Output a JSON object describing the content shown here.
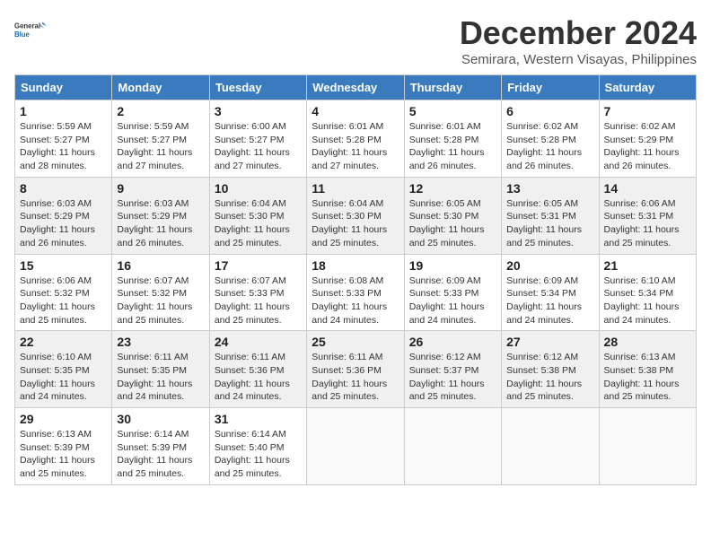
{
  "logo": {
    "general": "General",
    "blue": "Blue"
  },
  "title": "December 2024",
  "location": "Semirara, Western Visayas, Philippines",
  "days_header": [
    "Sunday",
    "Monday",
    "Tuesday",
    "Wednesday",
    "Thursday",
    "Friday",
    "Saturday"
  ],
  "weeks": [
    [
      {
        "day": "1",
        "sunrise": "5:59 AM",
        "sunset": "5:27 PM",
        "daylight": "11 hours and 28 minutes."
      },
      {
        "day": "2",
        "sunrise": "5:59 AM",
        "sunset": "5:27 PM",
        "daylight": "11 hours and 27 minutes."
      },
      {
        "day": "3",
        "sunrise": "6:00 AM",
        "sunset": "5:27 PM",
        "daylight": "11 hours and 27 minutes."
      },
      {
        "day": "4",
        "sunrise": "6:01 AM",
        "sunset": "5:28 PM",
        "daylight": "11 hours and 27 minutes."
      },
      {
        "day": "5",
        "sunrise": "6:01 AM",
        "sunset": "5:28 PM",
        "daylight": "11 hours and 26 minutes."
      },
      {
        "day": "6",
        "sunrise": "6:02 AM",
        "sunset": "5:28 PM",
        "daylight": "11 hours and 26 minutes."
      },
      {
        "day": "7",
        "sunrise": "6:02 AM",
        "sunset": "5:29 PM",
        "daylight": "11 hours and 26 minutes."
      }
    ],
    [
      {
        "day": "8",
        "sunrise": "6:03 AM",
        "sunset": "5:29 PM",
        "daylight": "11 hours and 26 minutes."
      },
      {
        "day": "9",
        "sunrise": "6:03 AM",
        "sunset": "5:29 PM",
        "daylight": "11 hours and 26 minutes."
      },
      {
        "day": "10",
        "sunrise": "6:04 AM",
        "sunset": "5:30 PM",
        "daylight": "11 hours and 25 minutes."
      },
      {
        "day": "11",
        "sunrise": "6:04 AM",
        "sunset": "5:30 PM",
        "daylight": "11 hours and 25 minutes."
      },
      {
        "day": "12",
        "sunrise": "6:05 AM",
        "sunset": "5:30 PM",
        "daylight": "11 hours and 25 minutes."
      },
      {
        "day": "13",
        "sunrise": "6:05 AM",
        "sunset": "5:31 PM",
        "daylight": "11 hours and 25 minutes."
      },
      {
        "day": "14",
        "sunrise": "6:06 AM",
        "sunset": "5:31 PM",
        "daylight": "11 hours and 25 minutes."
      }
    ],
    [
      {
        "day": "15",
        "sunrise": "6:06 AM",
        "sunset": "5:32 PM",
        "daylight": "11 hours and 25 minutes."
      },
      {
        "day": "16",
        "sunrise": "6:07 AM",
        "sunset": "5:32 PM",
        "daylight": "11 hours and 25 minutes."
      },
      {
        "day": "17",
        "sunrise": "6:07 AM",
        "sunset": "5:33 PM",
        "daylight": "11 hours and 25 minutes."
      },
      {
        "day": "18",
        "sunrise": "6:08 AM",
        "sunset": "5:33 PM",
        "daylight": "11 hours and 24 minutes."
      },
      {
        "day": "19",
        "sunrise": "6:09 AM",
        "sunset": "5:33 PM",
        "daylight": "11 hours and 24 minutes."
      },
      {
        "day": "20",
        "sunrise": "6:09 AM",
        "sunset": "5:34 PM",
        "daylight": "11 hours and 24 minutes."
      },
      {
        "day": "21",
        "sunrise": "6:10 AM",
        "sunset": "5:34 PM",
        "daylight": "11 hours and 24 minutes."
      }
    ],
    [
      {
        "day": "22",
        "sunrise": "6:10 AM",
        "sunset": "5:35 PM",
        "daylight": "11 hours and 24 minutes."
      },
      {
        "day": "23",
        "sunrise": "6:11 AM",
        "sunset": "5:35 PM",
        "daylight": "11 hours and 24 minutes."
      },
      {
        "day": "24",
        "sunrise": "6:11 AM",
        "sunset": "5:36 PM",
        "daylight": "11 hours and 24 minutes."
      },
      {
        "day": "25",
        "sunrise": "6:11 AM",
        "sunset": "5:36 PM",
        "daylight": "11 hours and 25 minutes."
      },
      {
        "day": "26",
        "sunrise": "6:12 AM",
        "sunset": "5:37 PM",
        "daylight": "11 hours and 25 minutes."
      },
      {
        "day": "27",
        "sunrise": "6:12 AM",
        "sunset": "5:38 PM",
        "daylight": "11 hours and 25 minutes."
      },
      {
        "day": "28",
        "sunrise": "6:13 AM",
        "sunset": "5:38 PM",
        "daylight": "11 hours and 25 minutes."
      }
    ],
    [
      {
        "day": "29",
        "sunrise": "6:13 AM",
        "sunset": "5:39 PM",
        "daylight": "11 hours and 25 minutes."
      },
      {
        "day": "30",
        "sunrise": "6:14 AM",
        "sunset": "5:39 PM",
        "daylight": "11 hours and 25 minutes."
      },
      {
        "day": "31",
        "sunrise": "6:14 AM",
        "sunset": "5:40 PM",
        "daylight": "11 hours and 25 minutes."
      },
      null,
      null,
      null,
      null
    ]
  ]
}
